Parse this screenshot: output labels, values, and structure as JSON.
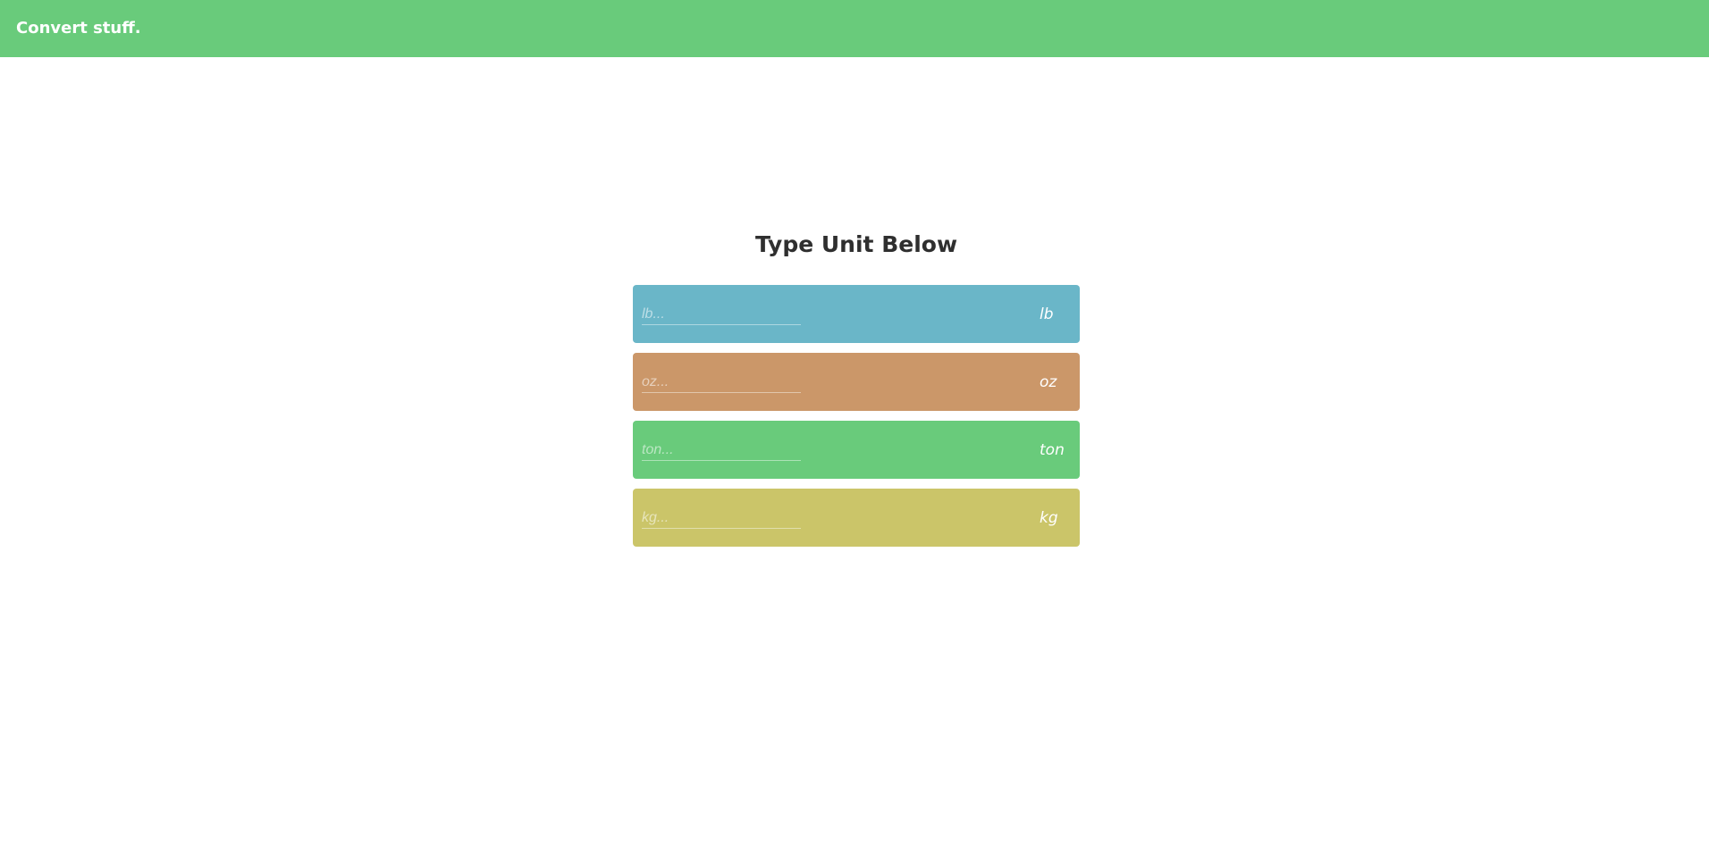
{
  "header": {
    "brand": "Convert stuff.",
    "background_color": "#69cb7b"
  },
  "main": {
    "title": "Type Unit Below",
    "converters": [
      {
        "placeholder": "lb...",
        "unit": "lb",
        "color": "#6ab6c8"
      },
      {
        "placeholder": "oz...",
        "unit": "oz",
        "color": "#cb9769"
      },
      {
        "placeholder": "ton...",
        "unit": "ton",
        "color": "#69cb7b"
      },
      {
        "placeholder": "kg...",
        "unit": "kg",
        "color": "#cbc569"
      }
    ]
  }
}
